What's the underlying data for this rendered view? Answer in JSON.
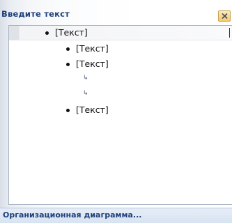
{
  "pane": {
    "title": "Введите текст",
    "close_icon": "close-icon"
  },
  "items": [
    {
      "text": "[Текст]",
      "level": 1,
      "marker": "bullet"
    },
    {
      "text": "[Текст]",
      "level": 2,
      "marker": "bullet"
    },
    {
      "text": "[Текст]",
      "level": 2,
      "marker": "bullet"
    },
    {
      "text": "",
      "level": 3,
      "marker": "arrow"
    },
    {
      "text": "",
      "level": 3,
      "marker": "arrow"
    },
    {
      "text": "[Текст]",
      "level": 2,
      "marker": "bullet"
    }
  ],
  "footer": {
    "label": "Организационная диаграмма..."
  }
}
